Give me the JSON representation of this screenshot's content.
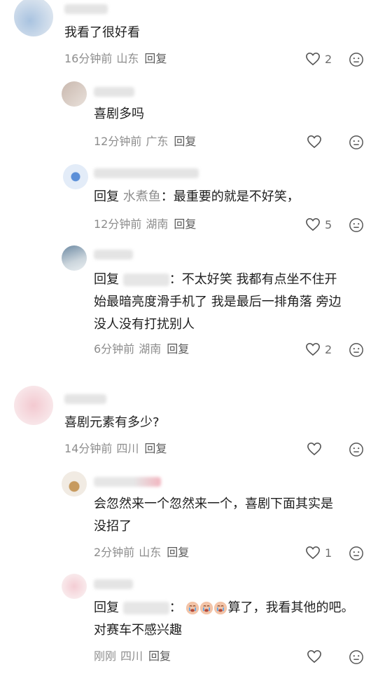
{
  "comments": [
    {
      "text": "我看了很好看",
      "time": "16分钟前",
      "location": "山东",
      "reply": "回复",
      "likes": "2"
    },
    {
      "text": "喜剧多吗",
      "time": "12分钟前",
      "location": "广东",
      "reply": "回复",
      "likes": ""
    },
    {
      "reply_prefix": "回复",
      "mention": "水煮鱼",
      "colon": "：",
      "text": "最重要的就是不好笑，",
      "time": "12分钟前",
      "location": "湖南",
      "reply": "回复",
      "likes": "5"
    },
    {
      "reply_prefix": "回复",
      "mention": "",
      "colon": "：",
      "text_line1": "不太好笑 我都有点坐不住开",
      "text_line2": "始最暗亮度滑手机了 我是最后一排角落 旁边",
      "text_line3": "没人没有打扰别人",
      "time": "6分钟前",
      "location": "湖南",
      "reply": "回复",
      "likes": "2"
    },
    {
      "text": "喜剧元素有多少?",
      "time": "14分钟前",
      "location": "四川",
      "reply": "回复",
      "likes": ""
    },
    {
      "text_line1": "会忽然来一个忽然来一个，喜剧下面其实是",
      "text_line2": "没招了",
      "time": "2分钟前",
      "location": "山东",
      "reply": "回复",
      "likes": "1"
    },
    {
      "reply_prefix": "回复",
      "mention": "",
      "colon": "：",
      "text_line1_suffix": "算了，我看其他的吧。",
      "text_line2": "对赛车不感兴趣",
      "time": "刚刚",
      "location": "四川",
      "reply": "回复",
      "likes": ""
    }
  ],
  "icons": {
    "like": "heart-outline-icon",
    "dislike": "neutral-face-icon",
    "emoji": "crying-face-emoji"
  },
  "colors": {
    "meta": "#8d8d8d",
    "text": "#1e1e1e",
    "icon": "#6f6f6f"
  }
}
